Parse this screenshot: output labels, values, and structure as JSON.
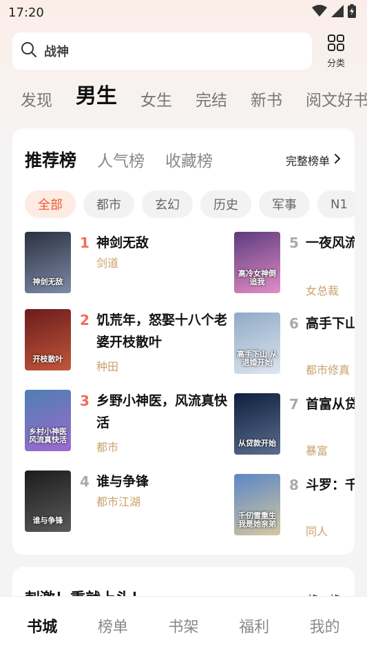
{
  "status_bar": {
    "time": "17:20"
  },
  "search": {
    "text": "战神"
  },
  "category_button": {
    "label": "分类"
  },
  "top_tabs": [
    {
      "label": "发现",
      "active": false
    },
    {
      "label": "男生",
      "active": true
    },
    {
      "label": "女生",
      "active": false
    },
    {
      "label": "完结",
      "active": false
    },
    {
      "label": "新书",
      "active": false
    },
    {
      "label": "阅文好书",
      "active": false
    }
  ],
  "rank_tabs": [
    {
      "label": "推荐榜",
      "active": true
    },
    {
      "label": "人气榜",
      "active": false
    },
    {
      "label": "收藏榜",
      "active": false
    }
  ],
  "full_list_label": "完整榜单",
  "chips": [
    {
      "label": "全部",
      "active": true
    },
    {
      "label": "都市",
      "active": false
    },
    {
      "label": "玄幻",
      "active": false
    },
    {
      "label": "历史",
      "active": false
    },
    {
      "label": "军事",
      "active": false
    },
    {
      "label": "N1",
      "active": false
    }
  ],
  "books": [
    {
      "rank": "1",
      "title": "神剑无敌",
      "tag": "剑道",
      "cover_text": "神剑无敌",
      "cover_colors": [
        "#2b3142",
        "#7f8aa8"
      ]
    },
    {
      "rank": "2",
      "title": "饥荒年，怒娶十八个老婆开枝散叶",
      "tag": "种田",
      "cover_text": "开枝散叶",
      "cover_colors": [
        "#6b1c1c",
        "#c2573a"
      ]
    },
    {
      "rank": "3",
      "title": "乡野小神医，风流真快活",
      "tag": "都市",
      "cover_text": "乡村小神医 风流真快活",
      "cover_colors": [
        "#4f7fb0",
        "#9c6ad0"
      ]
    },
    {
      "rank": "4",
      "title": "谁与争锋",
      "tag": "都市江湖",
      "cover_text": "谁与争锋",
      "cover_colors": [
        "#1c1c1c",
        "#5a5a5a"
      ]
    },
    {
      "rank": "5",
      "title": "一夜风流，神倒追我",
      "tag": "女总裁",
      "cover_text": "高冷女神倒追我",
      "cover_colors": [
        "#5d3b7d",
        "#e28ec6"
      ]
    },
    {
      "rank": "6",
      "title": "高手下山，开始",
      "tag": "都市修真",
      "cover_text": "高手下山 从退婚开始",
      "cover_colors": [
        "#8faac5",
        "#dfe6ef"
      ]
    },
    {
      "rank": "7",
      "title": "首富从贷，始",
      "tag": "暴富",
      "cover_text": "从贷款开始",
      "cover_colors": [
        "#0f1f3d",
        "#5c6d8f"
      ]
    },
    {
      "rank": "8",
      "title": "斗罗：千，生，我是",
      "tag": "同人",
      "cover_text": "千仞雪重生 我是她亲弟",
      "cover_colors": [
        "#5b87c5",
        "#d5c7a1"
      ]
    }
  ],
  "second_card": {
    "title": "刺激！重就上头！",
    "right": "换一换"
  },
  "bottom_nav": [
    {
      "label": "书城",
      "active": true
    },
    {
      "label": "榜单",
      "active": false
    },
    {
      "label": "书架",
      "active": false
    },
    {
      "label": "福利",
      "active": false
    },
    {
      "label": "我的",
      "active": false
    }
  ]
}
